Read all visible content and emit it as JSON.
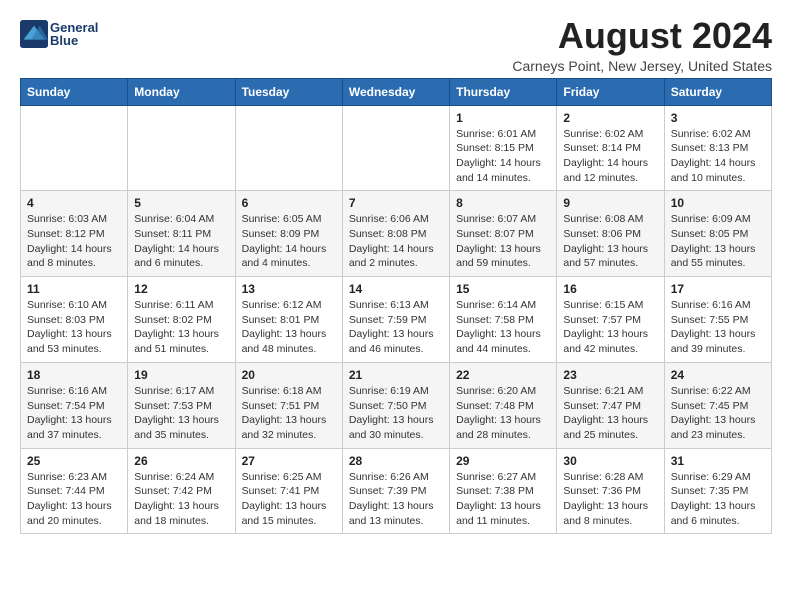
{
  "header": {
    "logo_line1": "General",
    "logo_line2": "Blue",
    "title": "August 2024",
    "subtitle": "Carneys Point, New Jersey, United States"
  },
  "weekdays": [
    "Sunday",
    "Monday",
    "Tuesday",
    "Wednesday",
    "Thursday",
    "Friday",
    "Saturday"
  ],
  "weeks": [
    [
      {
        "day": "",
        "info": ""
      },
      {
        "day": "",
        "info": ""
      },
      {
        "day": "",
        "info": ""
      },
      {
        "day": "",
        "info": ""
      },
      {
        "day": "1",
        "info": "Sunrise: 6:01 AM\nSunset: 8:15 PM\nDaylight: 14 hours\nand 14 minutes."
      },
      {
        "day": "2",
        "info": "Sunrise: 6:02 AM\nSunset: 8:14 PM\nDaylight: 14 hours\nand 12 minutes."
      },
      {
        "day": "3",
        "info": "Sunrise: 6:02 AM\nSunset: 8:13 PM\nDaylight: 14 hours\nand 10 minutes."
      }
    ],
    [
      {
        "day": "4",
        "info": "Sunrise: 6:03 AM\nSunset: 8:12 PM\nDaylight: 14 hours\nand 8 minutes."
      },
      {
        "day": "5",
        "info": "Sunrise: 6:04 AM\nSunset: 8:11 PM\nDaylight: 14 hours\nand 6 minutes."
      },
      {
        "day": "6",
        "info": "Sunrise: 6:05 AM\nSunset: 8:09 PM\nDaylight: 14 hours\nand 4 minutes."
      },
      {
        "day": "7",
        "info": "Sunrise: 6:06 AM\nSunset: 8:08 PM\nDaylight: 14 hours\nand 2 minutes."
      },
      {
        "day": "8",
        "info": "Sunrise: 6:07 AM\nSunset: 8:07 PM\nDaylight: 13 hours\nand 59 minutes."
      },
      {
        "day": "9",
        "info": "Sunrise: 6:08 AM\nSunset: 8:06 PM\nDaylight: 13 hours\nand 57 minutes."
      },
      {
        "day": "10",
        "info": "Sunrise: 6:09 AM\nSunset: 8:05 PM\nDaylight: 13 hours\nand 55 minutes."
      }
    ],
    [
      {
        "day": "11",
        "info": "Sunrise: 6:10 AM\nSunset: 8:03 PM\nDaylight: 13 hours\nand 53 minutes."
      },
      {
        "day": "12",
        "info": "Sunrise: 6:11 AM\nSunset: 8:02 PM\nDaylight: 13 hours\nand 51 minutes."
      },
      {
        "day": "13",
        "info": "Sunrise: 6:12 AM\nSunset: 8:01 PM\nDaylight: 13 hours\nand 48 minutes."
      },
      {
        "day": "14",
        "info": "Sunrise: 6:13 AM\nSunset: 7:59 PM\nDaylight: 13 hours\nand 46 minutes."
      },
      {
        "day": "15",
        "info": "Sunrise: 6:14 AM\nSunset: 7:58 PM\nDaylight: 13 hours\nand 44 minutes."
      },
      {
        "day": "16",
        "info": "Sunrise: 6:15 AM\nSunset: 7:57 PM\nDaylight: 13 hours\nand 42 minutes."
      },
      {
        "day": "17",
        "info": "Sunrise: 6:16 AM\nSunset: 7:55 PM\nDaylight: 13 hours\nand 39 minutes."
      }
    ],
    [
      {
        "day": "18",
        "info": "Sunrise: 6:16 AM\nSunset: 7:54 PM\nDaylight: 13 hours\nand 37 minutes."
      },
      {
        "day": "19",
        "info": "Sunrise: 6:17 AM\nSunset: 7:53 PM\nDaylight: 13 hours\nand 35 minutes."
      },
      {
        "day": "20",
        "info": "Sunrise: 6:18 AM\nSunset: 7:51 PM\nDaylight: 13 hours\nand 32 minutes."
      },
      {
        "day": "21",
        "info": "Sunrise: 6:19 AM\nSunset: 7:50 PM\nDaylight: 13 hours\nand 30 minutes."
      },
      {
        "day": "22",
        "info": "Sunrise: 6:20 AM\nSunset: 7:48 PM\nDaylight: 13 hours\nand 28 minutes."
      },
      {
        "day": "23",
        "info": "Sunrise: 6:21 AM\nSunset: 7:47 PM\nDaylight: 13 hours\nand 25 minutes."
      },
      {
        "day": "24",
        "info": "Sunrise: 6:22 AM\nSunset: 7:45 PM\nDaylight: 13 hours\nand 23 minutes."
      }
    ],
    [
      {
        "day": "25",
        "info": "Sunrise: 6:23 AM\nSunset: 7:44 PM\nDaylight: 13 hours\nand 20 minutes."
      },
      {
        "day": "26",
        "info": "Sunrise: 6:24 AM\nSunset: 7:42 PM\nDaylight: 13 hours\nand 18 minutes."
      },
      {
        "day": "27",
        "info": "Sunrise: 6:25 AM\nSunset: 7:41 PM\nDaylight: 13 hours\nand 15 minutes."
      },
      {
        "day": "28",
        "info": "Sunrise: 6:26 AM\nSunset: 7:39 PM\nDaylight: 13 hours\nand 13 minutes."
      },
      {
        "day": "29",
        "info": "Sunrise: 6:27 AM\nSunset: 7:38 PM\nDaylight: 13 hours\nand 11 minutes."
      },
      {
        "day": "30",
        "info": "Sunrise: 6:28 AM\nSunset: 7:36 PM\nDaylight: 13 hours\nand 8 minutes."
      },
      {
        "day": "31",
        "info": "Sunrise: 6:29 AM\nSunset: 7:35 PM\nDaylight: 13 hours\nand 6 minutes."
      }
    ]
  ]
}
